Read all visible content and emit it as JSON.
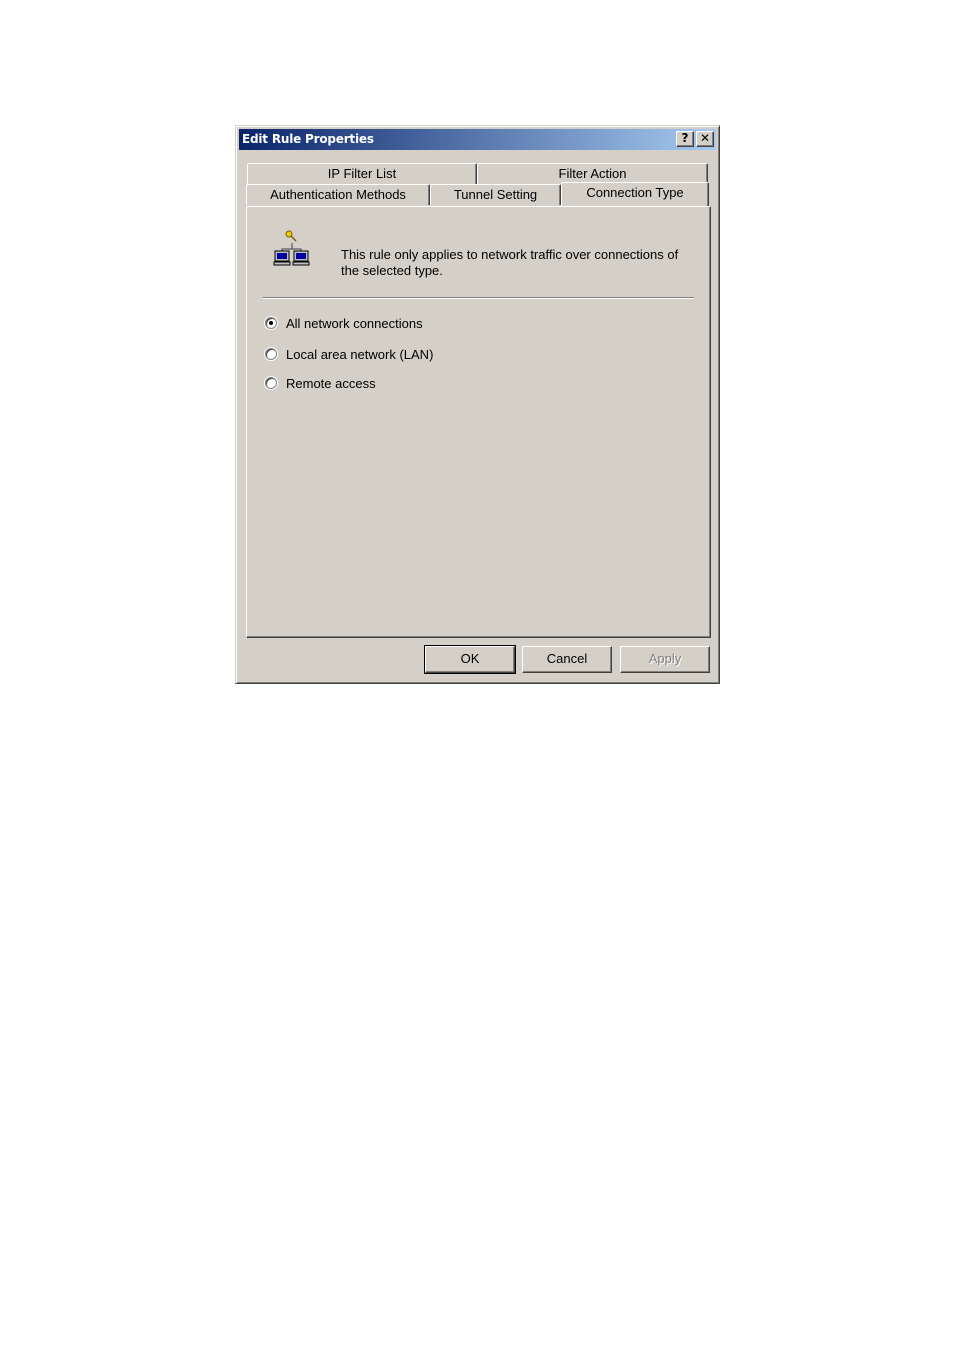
{
  "window": {
    "title": "Edit Rule Properties",
    "help_button": "?",
    "close_button": "✕"
  },
  "tabs": {
    "row_back": [
      {
        "label": "IP Filter List"
      },
      {
        "label": "Filter Action"
      }
    ],
    "row_front": [
      {
        "label": "Authentication Methods"
      },
      {
        "label": "Tunnel Setting"
      },
      {
        "label": "Connection Type",
        "active": true
      }
    ]
  },
  "panel": {
    "icon": "network-computers-icon",
    "description": "This rule only applies to network traffic over connections of the selected type.",
    "options": [
      {
        "label": "All network connections",
        "checked": true
      },
      {
        "label": "Local area network (LAN)",
        "checked": false
      },
      {
        "label": "Remote access",
        "checked": false
      }
    ]
  },
  "buttons": {
    "ok": "OK",
    "cancel": "Cancel",
    "apply": "Apply"
  },
  "colors": {
    "title_gradient_start": "#0a246a",
    "title_gradient_end": "#a6caf0",
    "face": "#d4d0c8"
  }
}
